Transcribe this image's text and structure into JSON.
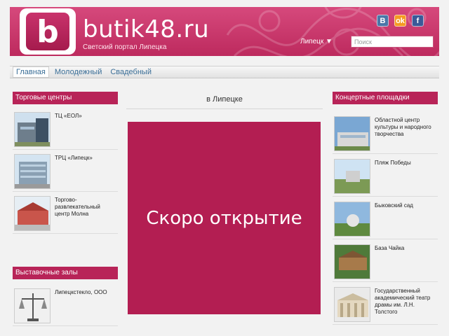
{
  "header": {
    "logo_letter": "b",
    "site_name": "butik48.ru",
    "tagline": "Светский портал Липецка",
    "city_label": "Липецк ▼",
    "search_placeholder": "Поиск",
    "socials": [
      {
        "label": "В",
        "icon": "vk-icon",
        "color": "#4a76a8"
      },
      {
        "label": "ok",
        "icon": "odnoklassniki-icon",
        "color": "#f59a23"
      },
      {
        "label": "f",
        "icon": "facebook-icon",
        "color": "#3b5998"
      }
    ]
  },
  "nav": {
    "items": [
      {
        "label": "Главная"
      },
      {
        "label": "Молодежный"
      },
      {
        "label": "Свадебный"
      }
    ]
  },
  "left": {
    "section1_title": "Торговые центры",
    "section1_items": [
      {
        "label": "ТЦ «ЕОЛ»"
      },
      {
        "label": "ТРЦ «Липецк»"
      },
      {
        "label": "Торгово-развлекательный центр Молна"
      }
    ],
    "section2_title": "Выставочные залы",
    "section2_items": [
      {
        "label": "Липецкстекло, ООО"
      }
    ]
  },
  "center": {
    "title": "в Липецке",
    "banner_text": "Скоро открытие"
  },
  "right": {
    "section_title": "Концертные площадки",
    "items": [
      {
        "label": "Областной центр культуры и народного творчества"
      },
      {
        "label": "Пляж Победы"
      },
      {
        "label": "Быковский сад"
      },
      {
        "label": "База Чайка"
      },
      {
        "label": "Государственный академический театр драмы им. Л.Н. Толстого"
      }
    ]
  },
  "colors": {
    "brand": "#b82458",
    "banner": "#b31e52",
    "nav_link": "#3a6e97"
  }
}
